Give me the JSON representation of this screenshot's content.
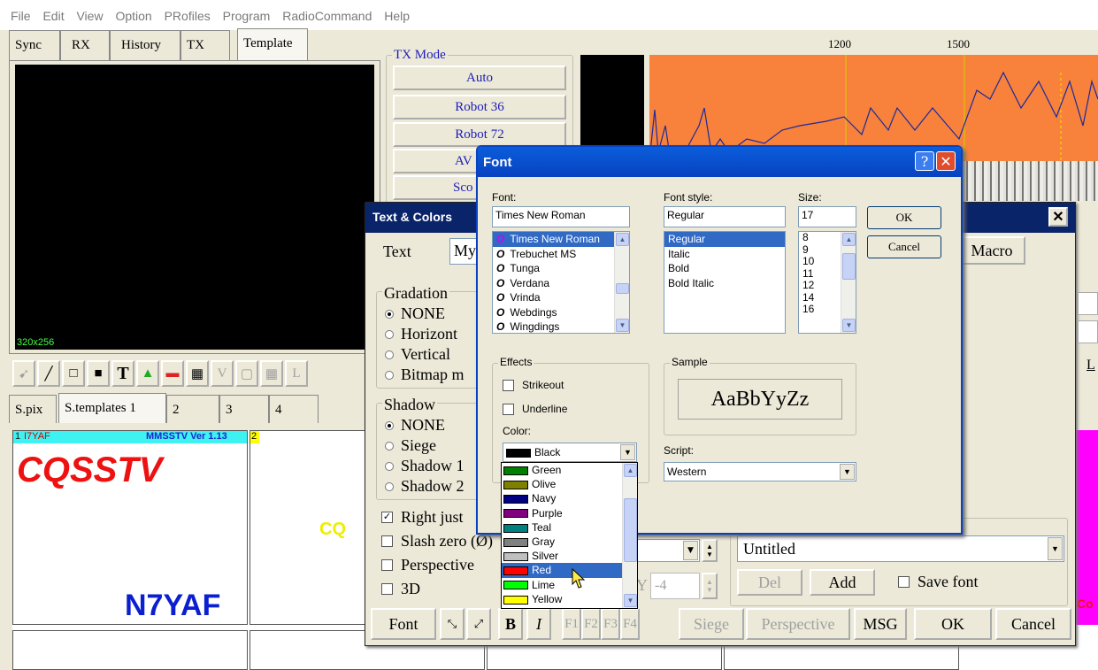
{
  "menu": [
    "File",
    "Edit",
    "View",
    "Option",
    "PRofiles",
    "Program",
    "RadioCommand",
    "Help"
  ],
  "main_tabs": [
    {
      "label": "Sync"
    },
    {
      "label": "RX"
    },
    {
      "label": "History"
    },
    {
      "label": "TX"
    },
    {
      "label": "Template"
    }
  ],
  "preview": {
    "size_label": "320x256"
  },
  "tx_mode": {
    "title": "TX Mode",
    "modes": [
      "Auto",
      "Robot 36",
      "Robot 72",
      "AV",
      "Sco"
    ]
  },
  "spectrum": {
    "freq_labels": [
      "1200",
      "1500"
    ]
  },
  "template_tabs": [
    {
      "label": "S.pix"
    },
    {
      "label": "S.templates 1"
    },
    {
      "label": "2"
    },
    {
      "label": "3"
    },
    {
      "label": "4"
    }
  ],
  "thumbnail": {
    "index1": "1",
    "index2": "2",
    "callsign_top": "I7YAF",
    "version": "MMSSTV Ver 1.13",
    "cq_text": "CQSSTV",
    "callsign": "N7YAF",
    "cq_small": "CQ",
    "right_text": "Co"
  },
  "text_colors": {
    "title": "Text & Colors",
    "text_label": "Text",
    "text_value": "My",
    "macro_button": "Macro",
    "gradation": {
      "title": "Gradation",
      "options": [
        "NONE",
        "Horizont",
        "Vertical",
        "Bitmap m"
      ],
      "selected": 0
    },
    "shadow": {
      "title": "Shadow",
      "options": [
        "NONE",
        "Siege",
        "Shadow 1",
        "Shadow 2"
      ],
      "selected": 0
    },
    "checks": [
      {
        "label": "Right just",
        "checked": true
      },
      {
        "label": "Slash zero (Ø)",
        "checked": false
      },
      {
        "label": "Perspective",
        "checked": false
      },
      {
        "label": "3D",
        "checked": false
      }
    ],
    "y_label": "Y",
    "y_value": "-4",
    "profile_value": "Untitled",
    "del_button": "Del",
    "add_button": "Add",
    "save_font_label": "Save font",
    "bottom": {
      "font": "Font",
      "bold": "B",
      "italic": "I",
      "f1": "F1",
      "f2": "F2",
      "f3": "F3",
      "f4": "F4",
      "siege": "Siege",
      "perspective": "Perspective",
      "msg": "MSG",
      "ok": "OK",
      "cancel": "Cancel"
    },
    "right_label": "L"
  },
  "font_dialog": {
    "title": "Font",
    "help": "?",
    "font_label": "Font:",
    "font_value": "Times New Roman",
    "fonts": [
      "Times New Roman",
      "Trebuchet MS",
      "Tunga",
      "Verdana",
      "Vrinda",
      "Webdings",
      "Wingdings"
    ],
    "style_label": "Font style:",
    "style_value": "Regular",
    "styles": [
      "Regular",
      "Italic",
      "Bold",
      "Bold Italic"
    ],
    "size_label": "Size:",
    "size_value": "17",
    "sizes": [
      "8",
      "9",
      "10",
      "11",
      "12",
      "14",
      "16"
    ],
    "ok": "OK",
    "cancel": "Cancel",
    "effects_label": "Effects",
    "strikeout": "Strikeout",
    "underline": "Underline",
    "color_label": "Color:",
    "color_value": "Black",
    "sample_label": "Sample",
    "sample_text": "AaBbYyZz",
    "script_label": "Script:",
    "script_value": "Western",
    "color_options": [
      {
        "name": "Green",
        "hex": "#008000"
      },
      {
        "name": "Olive",
        "hex": "#808000"
      },
      {
        "name": "Navy",
        "hex": "#000080"
      },
      {
        "name": "Purple",
        "hex": "#800080"
      },
      {
        "name": "Teal",
        "hex": "#008080"
      },
      {
        "name": "Gray",
        "hex": "#808080"
      },
      {
        "name": "Silver",
        "hex": "#c0c0c0"
      },
      {
        "name": "Red",
        "hex": "#ff0000"
      },
      {
        "name": "Lime",
        "hex": "#00ff00"
      },
      {
        "name": "Yellow",
        "hex": "#ffff00"
      }
    ],
    "color_highlighted": "Red"
  },
  "colors": {
    "spectrum_bg": "#f8823c",
    "dialog_title": "#0a246a",
    "selection": "#316ac5",
    "cq_red": "#ee1111",
    "call_blue": "#0b1fd0"
  }
}
